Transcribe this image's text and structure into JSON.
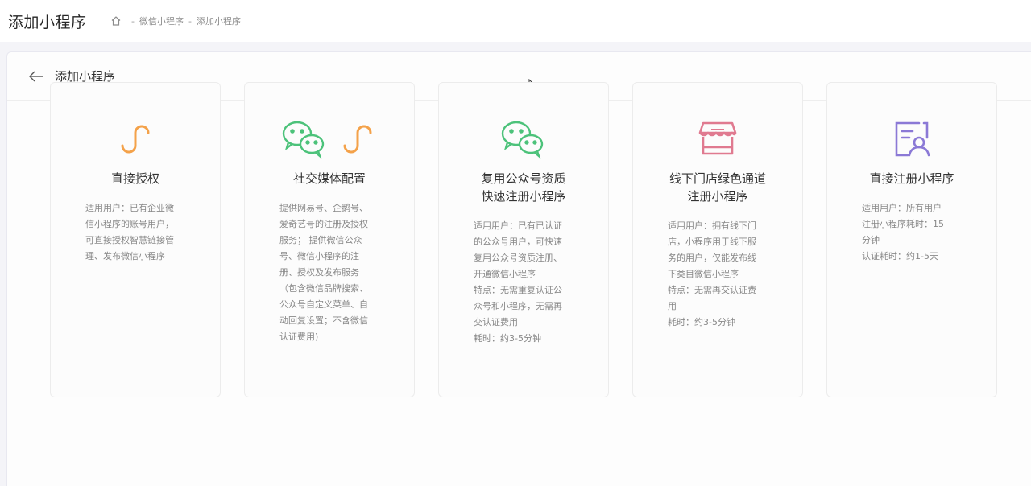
{
  "header": {
    "page_title": "添加小程序",
    "breadcrumb": [
      "微信小程序",
      "添加小程序"
    ],
    "separator": "-"
  },
  "panel": {
    "title": "添加小程序"
  },
  "cards": [
    {
      "icon": "mini-program-icon",
      "title": "直接授权",
      "desc": "适用用户：已有企业微\n信小程序的账号用户，\n可直接授权智慧链接管\n理、发布微信小程序"
    },
    {
      "icon": "wechat-and-mini-program-icon",
      "title": "社交媒体配置",
      "desc": "提供网易号、企鹅号、\n爱奇艺号的注册及授权\n服务； 提供微信公众\n号、微信小程序的注\n册、授权及发布服务\n（包含微信品牌搜索、\n公众号自定义菜单、自\n动回复设置；不含微信\n认证费用)"
    },
    {
      "icon": "wechat-icon",
      "title": "复用公众号资质\n快速注册小程序",
      "desc": "适用用户：已有已认证\n的公众号用户，可快速\n复用公众号资质注册、\n开通微信小程序\n特点：无需重复认证公\n众号和小程序，无需再\n交认证费用\n耗时：约3-5分钟"
    },
    {
      "icon": "store-icon",
      "title": "线下门店绿色通道\n注册小程序",
      "desc": "适用用户：拥有线下门\n店，小程序用于线下服\n务的用户，仅能发布线\n下类目微信小程序\n特点：无需再交认证费\n用\n耗时：约3-5分钟"
    },
    {
      "icon": "register-profile-icon",
      "title": "直接注册小程序",
      "desc": "适用用户：所有用户\n注册小程序耗时：15\n分钟\n认证耗时：约1-5天"
    }
  ],
  "colors": {
    "orange": "#f4a24a",
    "green": "#4cc27a",
    "pink": "#e07a90",
    "purple": "#8b79d6"
  }
}
